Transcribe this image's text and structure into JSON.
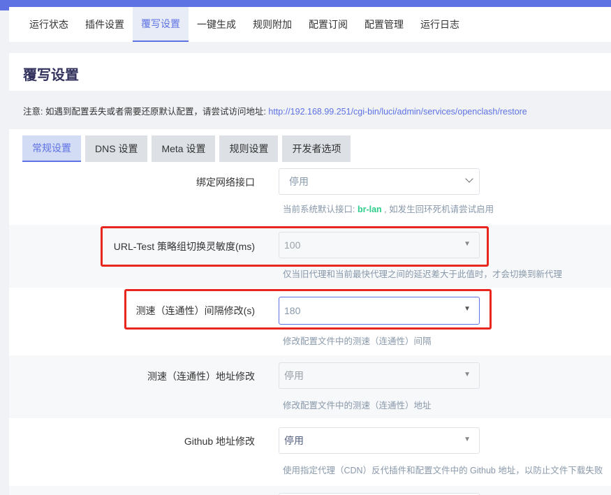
{
  "nav": {
    "tabs": [
      {
        "label": "运行状态"
      },
      {
        "label": "插件设置"
      },
      {
        "label": "覆写设置",
        "active": true
      },
      {
        "label": "一键生成"
      },
      {
        "label": "规则附加"
      },
      {
        "label": "配置订阅"
      },
      {
        "label": "配置管理"
      },
      {
        "label": "运行日志"
      }
    ]
  },
  "page": {
    "title": "覆写设置",
    "notice_text": "注意: 如遇到配置丢失或者需要还原默认配置，请尝试访问地址: ",
    "notice_link": "http://192.168.99.251/cgi-bin/luci/admin/services/openclash/restore"
  },
  "tabs": [
    {
      "label": "常规设置",
      "active": true
    },
    {
      "label": "DNS 设置"
    },
    {
      "label": "Meta 设置"
    },
    {
      "label": "规则设置"
    },
    {
      "label": "开发者选项"
    }
  ],
  "settings": [
    {
      "label": "绑定网络接口",
      "value": "停用",
      "hint_prefix": "当前系统默认接口: ",
      "hint_code": "br-lan",
      "hint_suffix": " , 如发生回环死机请尝试启用"
    },
    {
      "label": "URL-Test 策略组切换灵敏度(ms)",
      "value": "100",
      "hint": "仅当旧代理和当前最快代理之间的延迟差大于此值时，才会切换到新代理"
    },
    {
      "label": "测速（连通性）间隔修改(s)",
      "value": "180",
      "hint": "修改配置文件中的测速（连通性）间隔"
    },
    {
      "label": "测速（连通性）地址修改",
      "value": "停用",
      "hint": "修改配置文件中的测速（连通性）地址"
    },
    {
      "label": "Github 地址修改",
      "value": "停用",
      "hint": "使用指定代理（CDN）反代插件和配置文件中的 Github 地址，以防止文件下载失败"
    }
  ],
  "colors": {
    "accent": "#5e72e4",
    "highlight_border": "#e8261d",
    "interface_code": "#2dce89"
  }
}
